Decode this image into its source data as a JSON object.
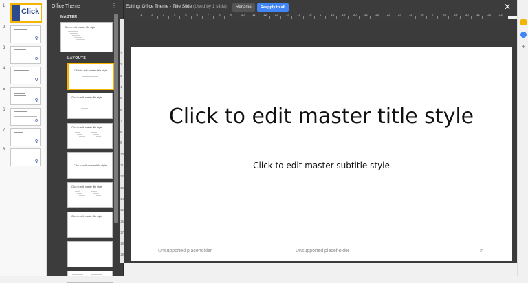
{
  "filmstrip": {
    "slides": [
      {
        "number": "1",
        "logo_text": "Click"
      },
      {
        "number": "2"
      },
      {
        "number": "3"
      },
      {
        "number": "4"
      },
      {
        "number": "5"
      },
      {
        "number": "6"
      },
      {
        "number": "7"
      },
      {
        "number": "8"
      }
    ]
  },
  "master_panel": {
    "title": "Office Theme",
    "master_label": "MASTER",
    "layouts_label": "LAYOUTS",
    "master_thumb_text": "Click to edit master title style",
    "layouts": [
      {
        "text": "Click to edit master title style"
      },
      {
        "text": "Click to edit master title style"
      },
      {
        "text": "Click to edit master title style"
      },
      {
        "text": "Click to edit master title style"
      },
      {
        "text": "Click to edit master title style"
      },
      {
        "text": "Click to edit master title style"
      },
      {
        "text": ""
      }
    ]
  },
  "editor": {
    "title": "Editing: Office Theme - Title Slide",
    "usage": "(Used by 1 slide)",
    "rename_label": "Rename",
    "reapply_label": "Reapply to all",
    "close_icon": "close-icon"
  },
  "ruler": {
    "h_numbers": [
      "1",
      "2",
      "3",
      "4",
      "5",
      "6",
      "7",
      "8",
      "9",
      "10",
      "11",
      "12",
      "13",
      "14",
      "15",
      "16",
      "17",
      "18",
      "19",
      "20",
      "21",
      "22",
      "23",
      "24",
      "25",
      "26",
      "27",
      "28",
      "29",
      "30",
      "31",
      "32",
      "33"
    ],
    "v_numbers": [
      "1",
      "2",
      "3",
      "4",
      "5",
      "6",
      "7",
      "8",
      "9",
      "10",
      "11",
      "12",
      "13",
      "14",
      "15",
      "16",
      "17",
      "18",
      "19"
    ]
  },
  "slide": {
    "title": "Click to edit master title style",
    "subtitle": "Click to edit master subtitle style",
    "footer_left": "Unsupported placeholder",
    "footer_center": "Unsupported placeholder",
    "slide_number": "#"
  },
  "colors": {
    "accent": "#4285f4",
    "selection": "#f4b400",
    "panel_bg": "#3c3c3c"
  }
}
